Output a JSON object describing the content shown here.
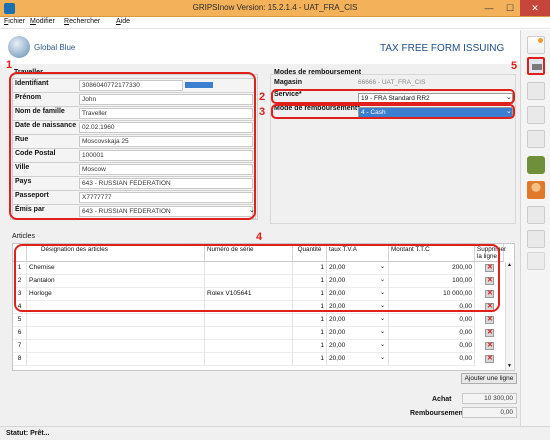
{
  "window": {
    "title": "GRIPSInow Version: 15.2.1.4 - UAT_FRA_CIS",
    "min": "—",
    "max": "☐",
    "close": "✕"
  },
  "menu": {
    "items": [
      {
        "label": "Fichier",
        "accel": "F",
        "rest": "ichier"
      },
      {
        "label": "Modifier",
        "accel": "M",
        "rest": "odifier"
      },
      {
        "label": "Rechercher",
        "accel": "R",
        "rest": "echercher"
      },
      {
        "label": "Aide",
        "accel": "A",
        "rest": "ide"
      }
    ]
  },
  "header": {
    "brand": "Global Blue",
    "form_title": "TAX FREE FORM ISSUING"
  },
  "traveller": {
    "section": "Traveller",
    "fields": [
      {
        "label": "Identifiant",
        "value": "3086040772177330"
      },
      {
        "label": "Prénom",
        "value": "John"
      },
      {
        "label": "Nom de famille",
        "value": "Traveller"
      },
      {
        "label": "Date de naissance",
        "value": "02.02.1960"
      },
      {
        "label": "Rue",
        "value": "Moscovskaja 25"
      },
      {
        "label": "Code Postal",
        "value": "100001"
      },
      {
        "label": "Ville",
        "value": "Moscow"
      },
      {
        "label": "Pays",
        "value": "643 - RUSSIAN FEDERATION"
      },
      {
        "label": "Passeport",
        "value": "X7777777"
      },
      {
        "label": "Émis par",
        "value": "643 - RUSSIAN FEDERATION"
      }
    ]
  },
  "refund": {
    "section": "Modes de remboursement",
    "magasin_label": "Magasin",
    "magasin_value": "66666 - UAT_FRA_CIS",
    "service_label": "Service*",
    "service_value": "19 - FRA Standard RR2",
    "mode_label": "Mode de remboursement*",
    "mode_value": "4 - Cash"
  },
  "articles": {
    "section": "Articles",
    "headers": {
      "designation": "Désignation des articles",
      "serial": "Numéro de série",
      "qty": "Quantité",
      "tva": "taux T.V.A",
      "amount": "Montant T.T.C",
      "delete": "Supprimer la ligne"
    },
    "rows": [
      {
        "n": "1",
        "designation": "Chemise",
        "serial": "",
        "qty": "1",
        "tva": "20,00",
        "amount": "200,00"
      },
      {
        "n": "2",
        "designation": "Pantalon",
        "serial": "",
        "qty": "1",
        "tva": "20,00",
        "amount": "100,00"
      },
      {
        "n": "3",
        "designation": "Horloge",
        "serial": "Rolex V105641",
        "qty": "1",
        "tva": "20,00",
        "amount": "10 000,00"
      },
      {
        "n": "4",
        "designation": "",
        "serial": "",
        "qty": "1",
        "tva": "20,00",
        "amount": "0,00"
      },
      {
        "n": "5",
        "designation": "",
        "serial": "",
        "qty": "1",
        "tva": "20,00",
        "amount": "0,00"
      },
      {
        "n": "6",
        "designation": "",
        "serial": "",
        "qty": "1",
        "tva": "20,00",
        "amount": "0,00"
      },
      {
        "n": "7",
        "designation": "",
        "serial": "",
        "qty": "1",
        "tva": "20,00",
        "amount": "0,00"
      },
      {
        "n": "8",
        "designation": "",
        "serial": "",
        "qty": "1",
        "tva": "20,00",
        "amount": "0,00"
      }
    ],
    "add_line": "Ajouter une ligne"
  },
  "totals": {
    "achat_label": "Achat",
    "achat_value": "10 300,00",
    "remb_label": "Remboursement",
    "remb_value": "0,00"
  },
  "status": {
    "text": "Statut: Prêt..."
  },
  "callouts": [
    "1",
    "2",
    "3",
    "4",
    "5"
  ],
  "colors": {
    "titlebar": "#f3b25a",
    "accent": "#3c7ed0",
    "callout": "#e0201b",
    "brand": "#2f5d8e"
  }
}
